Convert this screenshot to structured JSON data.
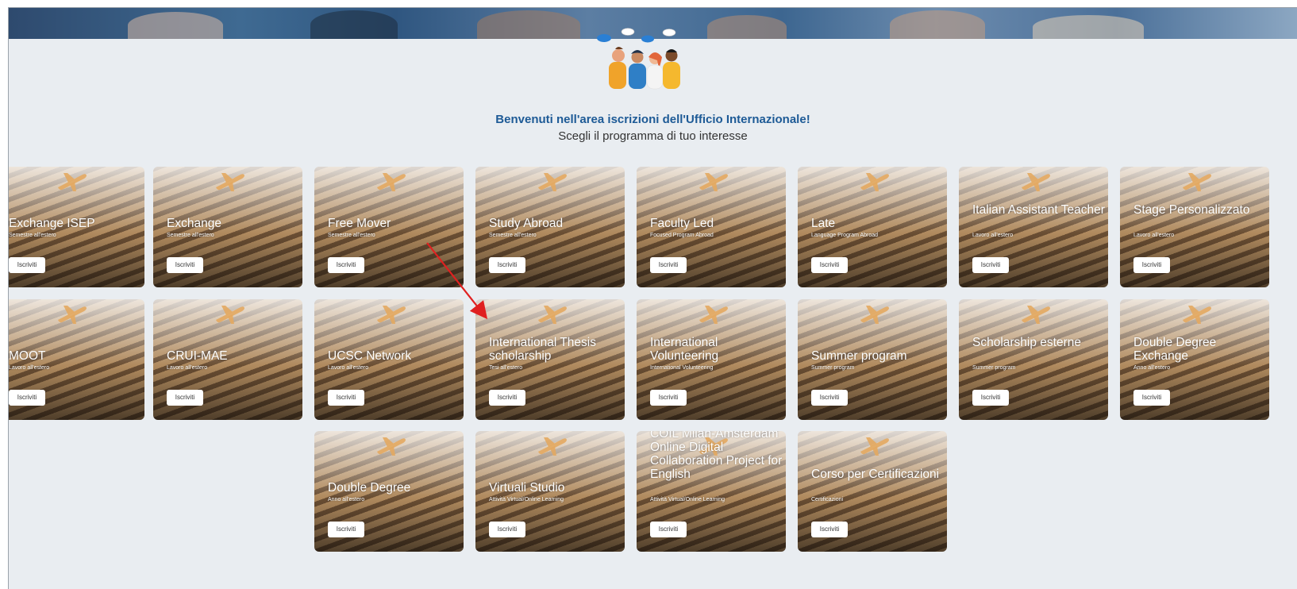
{
  "header": {
    "title": "Benvenuti nell'area iscrizioni dell'Ufficio Internazionale!",
    "subtitle": "Scegli il programma di tuo interesse"
  },
  "button_label": "Iscriviti",
  "programs": [
    {
      "title": "Exchange ISEP",
      "subtitle": "Semestre all'estero"
    },
    {
      "title": "Exchange",
      "subtitle": "Semestre all'estero"
    },
    {
      "title": "Free Mover",
      "subtitle": "Semestre all'estero"
    },
    {
      "title": "Study Abroad",
      "subtitle": "Semestre all'estero"
    },
    {
      "title": "Faculty Led",
      "subtitle": "Focused Program Abroad"
    },
    {
      "title": "Late",
      "subtitle": "Language Program Abroad"
    },
    {
      "title": "Italian Assistant Teacher",
      "subtitle": "Lavoro all'estero"
    },
    {
      "title": "Stage Personalizzato",
      "subtitle": "Lavoro all'estero"
    },
    {
      "title": "MOOT",
      "subtitle": "Lavoro all'estero"
    },
    {
      "title": "CRUI-MAE",
      "subtitle": "Lavoro all'estero"
    },
    {
      "title": "UCSC Network",
      "subtitle": "Lavoro all'estero"
    },
    {
      "title": "International Thesis scholarship",
      "subtitle": "Tesi all'estero"
    },
    {
      "title": "International Volunteering",
      "subtitle": "International Volunteering"
    },
    {
      "title": "Summer program",
      "subtitle": "Summer program"
    },
    {
      "title": "Scholarship esterne",
      "subtitle": "Summer program"
    },
    {
      "title": "Double Degree Exchange",
      "subtitle": "Anno all'estero"
    },
    {
      "title": "Double Degree",
      "subtitle": "Anno all'estero"
    },
    {
      "title": "Virtuali Studio",
      "subtitle": "Attività Virtual/Online Learning"
    },
    {
      "title": "COIL Milan-Amsterdam Online Digital Collaboration Project for English",
      "subtitle": "Attività Virtual/Online Learning"
    },
    {
      "title": "Corso per Certificazioni",
      "subtitle": "Certificazioni"
    }
  ],
  "colors": {
    "title_blue": "#1d5a96",
    "page_background": "#e9edf1",
    "annotation_arrow": "#e02020"
  }
}
